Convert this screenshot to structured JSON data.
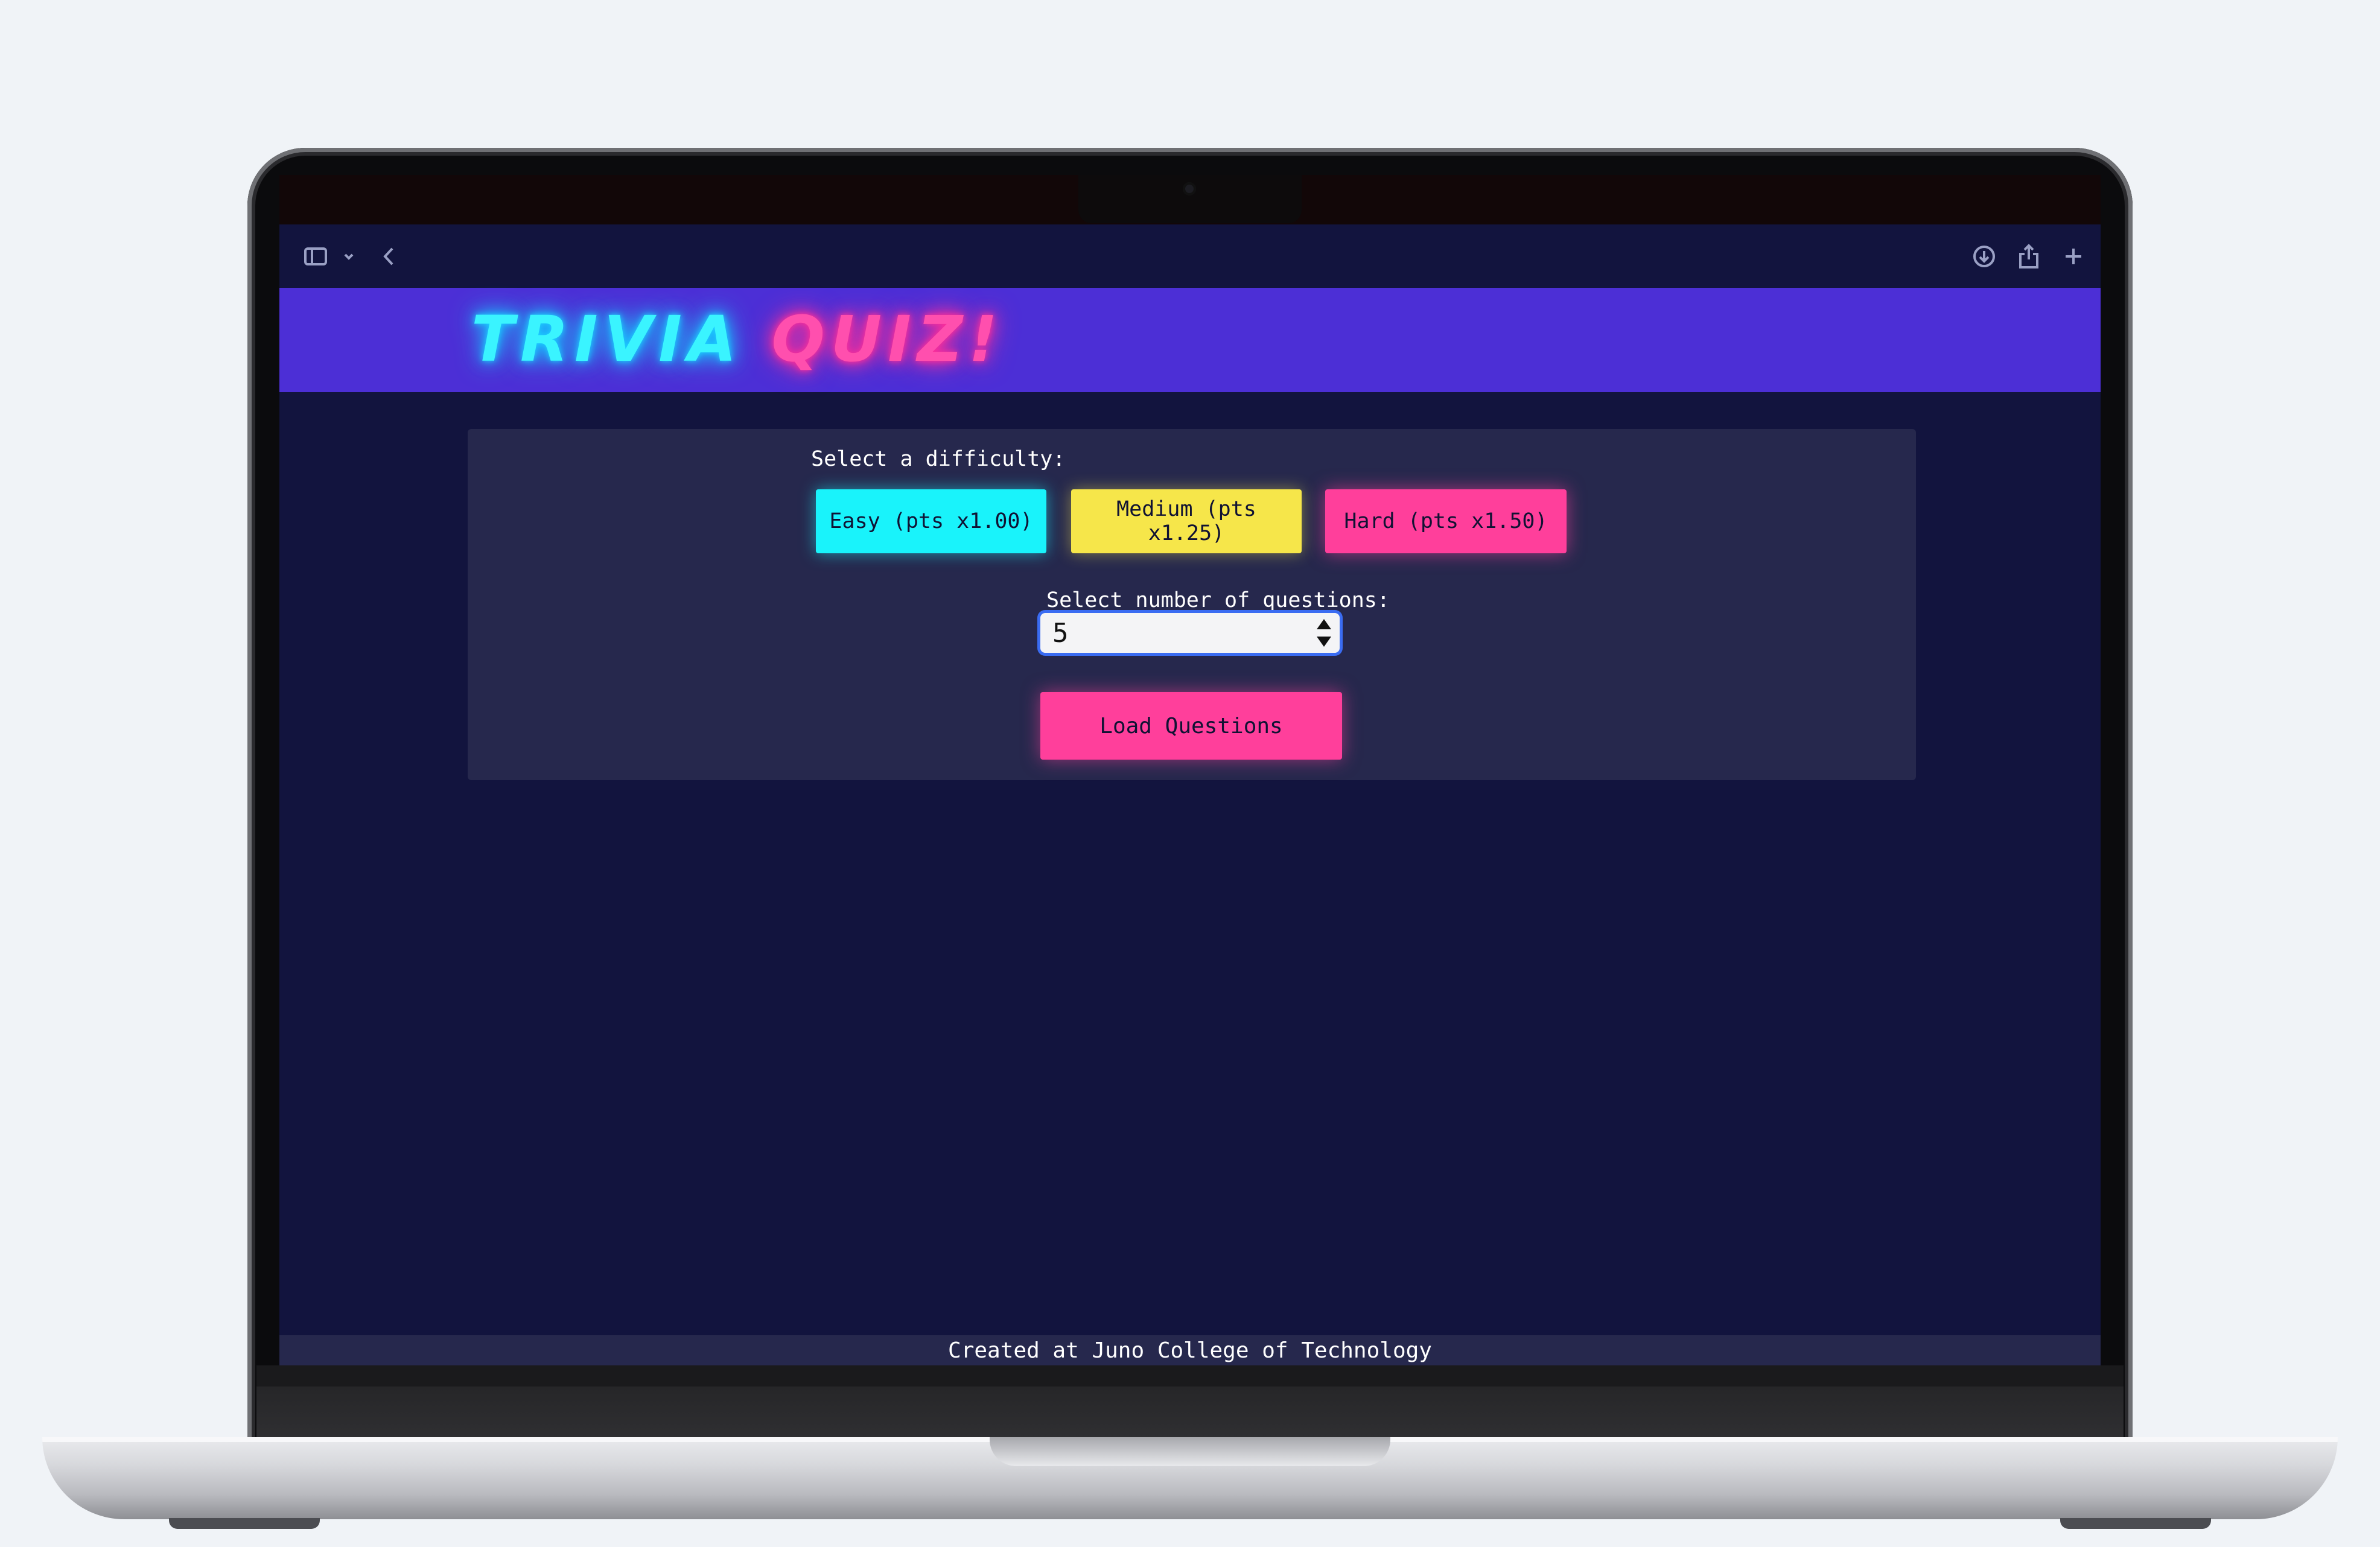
{
  "app": {
    "title_word_1": "TRIVIA",
    "title_word_2": "QUIZ!"
  },
  "browser_toolbar": {
    "icons": [
      "sidebar-icon",
      "chevron-down-icon",
      "back-arrow-icon",
      "download-icon",
      "share-icon",
      "plus-icon"
    ]
  },
  "difficulty": {
    "label": "Select a difficulty:",
    "options": [
      {
        "label": "Easy (pts x1.00)",
        "color": "#19f3fb"
      },
      {
        "label": "Medium (pts x1.25)",
        "color": "#f6e64a"
      },
      {
        "label": "Hard (pts x1.50)",
        "color": "#ff3f9b"
      }
    ]
  },
  "questions": {
    "label": "Select number of questions:",
    "value": "5"
  },
  "load_button": {
    "label": "Load Questions",
    "color": "#ff3f9b"
  },
  "footer": {
    "text": "Created at Juno College of Technology"
  },
  "colors": {
    "page_background": "#12143e",
    "header_background": "#4c2fd6",
    "panel_background": "#26284d",
    "title_cyan": "#3af4ff",
    "title_pink": "#ff4fae"
  }
}
